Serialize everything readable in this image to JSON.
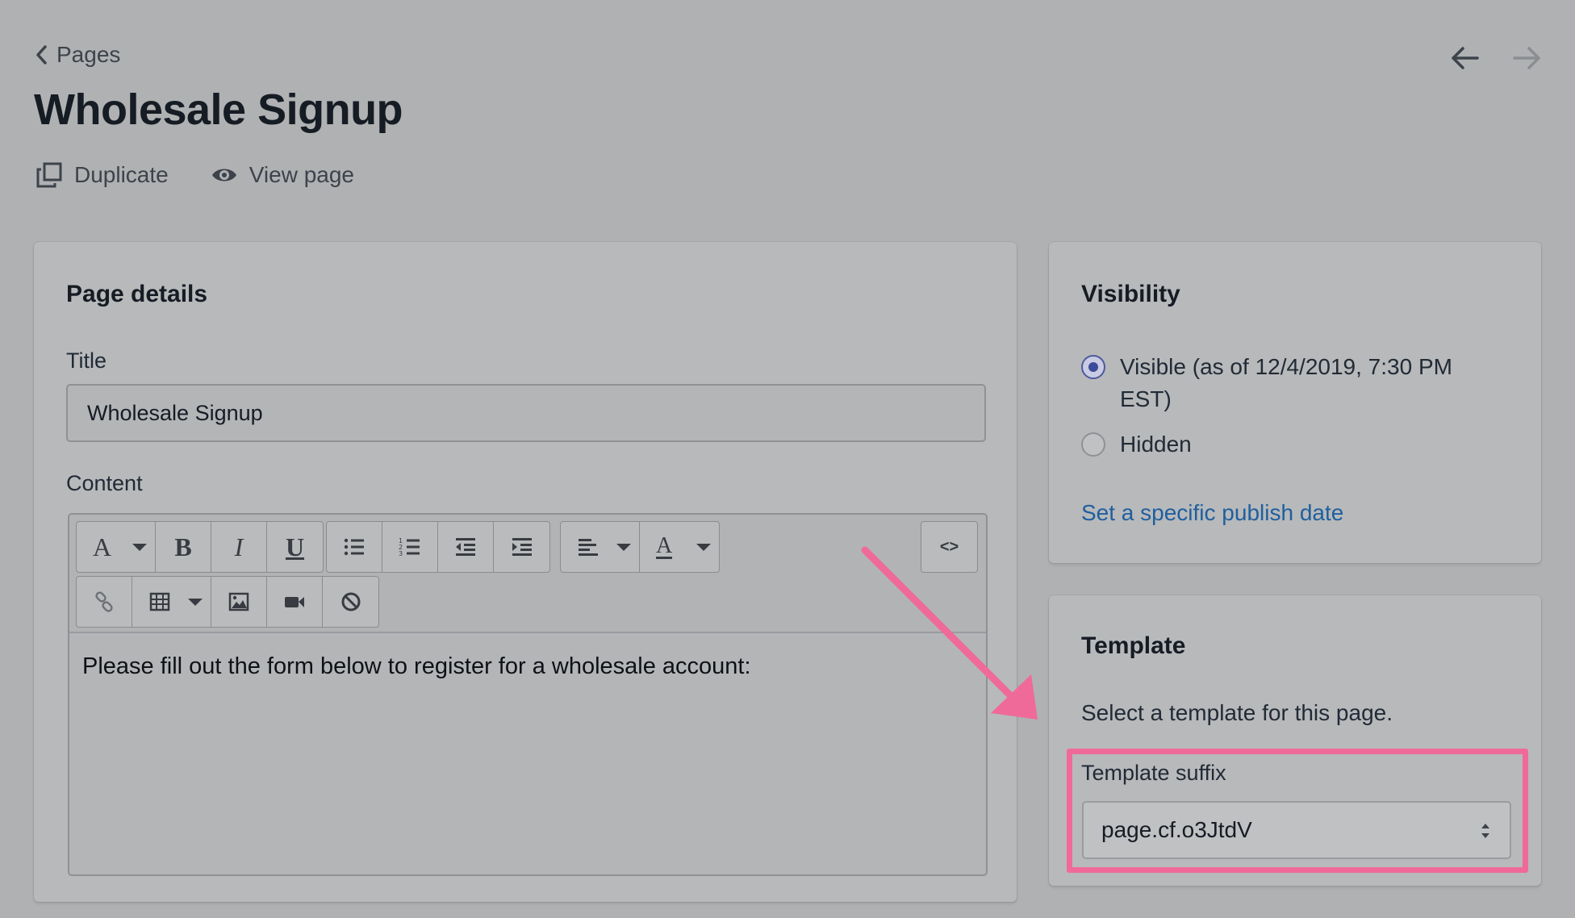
{
  "header": {
    "breadcrumb": "Pages",
    "title": "Wholesale Signup",
    "duplicate_label": "Duplicate",
    "view_page_label": "View page"
  },
  "page_details": {
    "heading": "Page details",
    "title_label": "Title",
    "title_value": "Wholesale Signup",
    "content_label": "Content",
    "toolbar": {
      "font_glyph": "A",
      "bold_glyph": "B",
      "italic_glyph": "I",
      "underline_glyph": "U",
      "text_color_glyph": "A",
      "html_glyph": "<>"
    },
    "content_text": "Please fill out the form below to register for a wholesale account:"
  },
  "visibility": {
    "heading": "Visibility",
    "options": [
      {
        "label": "Visible (as of 12/4/2019, 7:30 PM EST)",
        "selected": true
      },
      {
        "label": "Hidden",
        "selected": false
      }
    ],
    "publish_link": "Set a specific publish date"
  },
  "template": {
    "heading": "Template",
    "description": "Select a template for this page.",
    "suffix_label": "Template suffix",
    "suffix_value": "page.cf.o3JtdV"
  },
  "colors": {
    "background": "#b0b1b3",
    "link": "#1f5f9e",
    "radio_selected": "#3b4a99",
    "highlight": "#ef6a98"
  }
}
